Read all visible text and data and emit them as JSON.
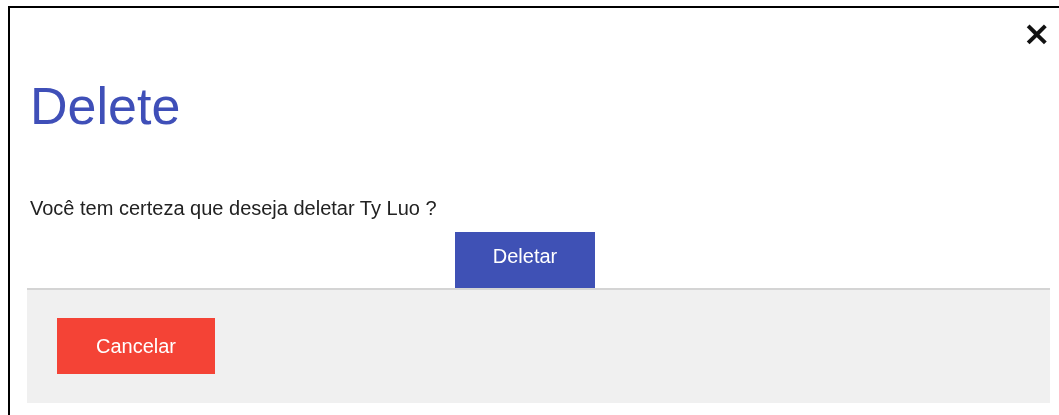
{
  "dialog": {
    "close": "×",
    "title": "Delete",
    "message": "Você tem certeza que deseja deletar Ty Luo ?",
    "confirm_button": "Deletar",
    "cancel_button": "Cancelar"
  }
}
